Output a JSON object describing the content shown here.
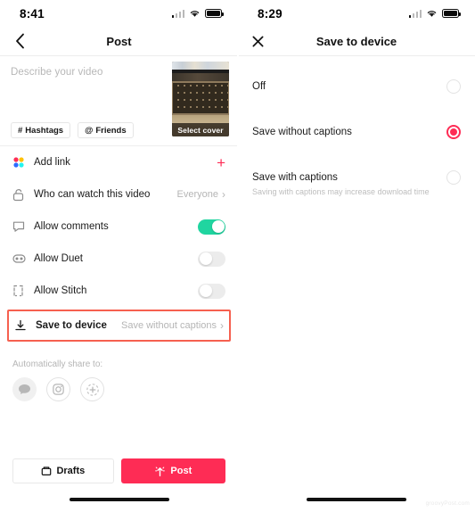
{
  "left_screen": {
    "status": {
      "time": "8:41",
      "signal_icon": "signal-bars-icon",
      "wifi_icon": "wifi-icon",
      "battery_icon": "battery-icon"
    },
    "nav": {
      "back_icon": "chevron-left-icon",
      "title": "Post"
    },
    "compose": {
      "placeholder": "Describe your video",
      "value": "",
      "chips": [
        {
          "icon": "hashtag-icon",
          "glyph": "#",
          "label": "Hashtags"
        },
        {
          "icon": "at-mention-icon",
          "glyph": "@",
          "label": "Friends"
        }
      ],
      "cover": {
        "caption": "Select cover",
        "alt": "laptop-keyboard-thumbnail"
      }
    },
    "settings_rows": [
      {
        "icon": "color-dots-icon",
        "label": "Add link",
        "value": "",
        "control": "plus"
      },
      {
        "icon": "lock-icon",
        "label": "Who can watch this video",
        "value": "Everyone",
        "control": "chevron"
      },
      {
        "icon": "comment-bubble-icon",
        "label": "Allow comments",
        "value": "",
        "control": "toggle-on"
      },
      {
        "icon": "duet-icon",
        "label": "Allow Duet",
        "value": "",
        "control": "toggle-off"
      },
      {
        "icon": "stitch-icon",
        "label": "Allow Stitch",
        "value": "",
        "control": "toggle-off"
      }
    ],
    "highlighted_row": {
      "icon": "download-icon",
      "label": "Save to device",
      "value": "Save without captions",
      "control": "chevron",
      "highlight_color": "#f6604f"
    },
    "share": {
      "title": "Automatically share to:",
      "icons": [
        {
          "name": "messages-icon",
          "style": "filled"
        },
        {
          "name": "instagram-icon",
          "style": "outline"
        },
        {
          "name": "more-share-icon",
          "style": "outline"
        }
      ]
    },
    "footer": {
      "drafts": {
        "icon": "drafts-icon",
        "label": "Drafts"
      },
      "post": {
        "icon": "post-sparkle-icon",
        "label": "Post",
        "color": "#fe2c55"
      }
    }
  },
  "right_screen": {
    "status": {
      "time": "8:29",
      "signal_icon": "signal-bars-icon",
      "wifi_icon": "wifi-icon",
      "battery_icon": "battery-icon"
    },
    "nav": {
      "close_icon": "close-x-icon",
      "title": "Save to device"
    },
    "options": [
      {
        "label": "Off",
        "sub": "",
        "selected": false
      },
      {
        "label": "Save without captions",
        "sub": "",
        "selected": true
      },
      {
        "label": "Save with captions",
        "sub": "Saving with captions may increase download time",
        "selected": false
      }
    ],
    "accent_color": "#fe2c55"
  },
  "watermark": {
    "text": "groovyPost.com"
  }
}
